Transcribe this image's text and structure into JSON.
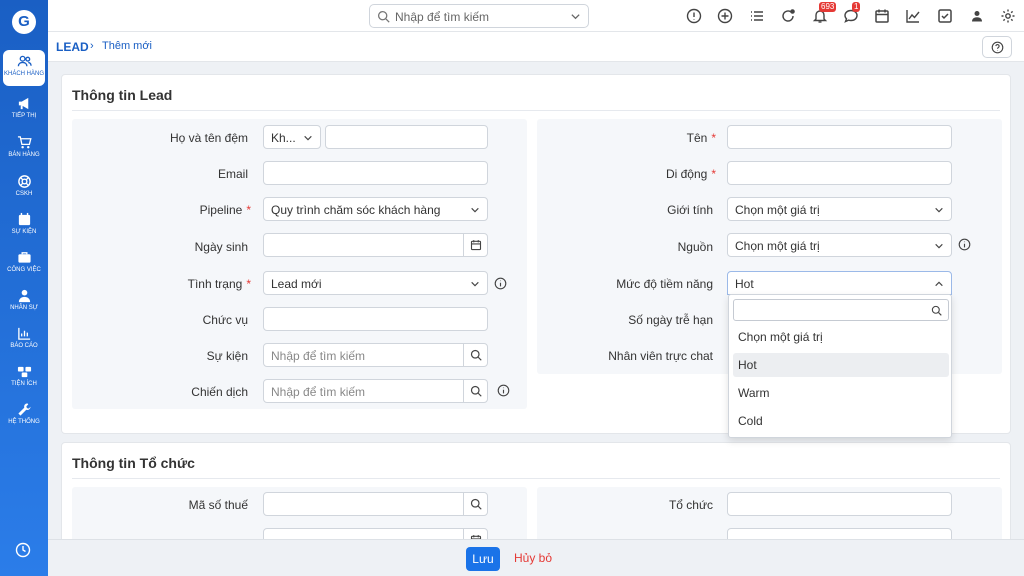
{
  "sidebar": {
    "logo": "G",
    "items": [
      {
        "label": "KHÁCH HÀNG",
        "icon": "users-icon"
      },
      {
        "label": "TIẾP THỊ",
        "icon": "megaphone-icon"
      },
      {
        "label": "BÁN HÀNG",
        "icon": "cart-icon"
      },
      {
        "label": "CSKH",
        "icon": "lifebuoy-icon"
      },
      {
        "label": "SỰ KIỆN",
        "icon": "calendar-icon"
      },
      {
        "label": "CÔNG VIỆC",
        "icon": "briefcase-icon"
      },
      {
        "label": "NHÂN SỰ",
        "icon": "person-icon"
      },
      {
        "label": "BÁO CÁO",
        "icon": "chart-icon"
      },
      {
        "label": "TIỆN ÍCH",
        "icon": "boxes-icon"
      },
      {
        "label": "HỆ THỐNG",
        "icon": "wrench-icon"
      }
    ]
  },
  "topbar": {
    "search_placeholder": "Nhập để tìm kiếm",
    "notifications_count": "693",
    "messages_count": "1"
  },
  "breadcrumb": {
    "root": "LEAD",
    "separator": "›",
    "current": "Thêm mới"
  },
  "lead_section": {
    "title": "Thông tin Lead",
    "left": {
      "fullname_label": "Họ và tên đệm",
      "salutation_value": "Kh...",
      "email_label": "Email",
      "pipeline_label": "Pipeline",
      "pipeline_value": "Quy trình chăm sóc khách hàng",
      "birthday_label": "Ngày sinh",
      "status_label": "Tình trạng",
      "status_value": "Lead mới",
      "position_label": "Chức vụ",
      "event_label": "Sự kiện",
      "event_placeholder": "Nhập để tìm kiếm",
      "campaign_label": "Chiến dịch",
      "campaign_placeholder": "Nhập để tìm kiếm"
    },
    "right": {
      "name_label": "Tên",
      "mobile_label": "Di động",
      "gender_label": "Giới tính",
      "gender_value": "Chọn một giá trị",
      "source_label": "Nguồn",
      "source_value": "Chọn một giá trị",
      "potential_label": "Mức độ tiềm năng",
      "potential_value": "Hot",
      "overdue_label": "Số ngày trễ hạn",
      "chat_label": "Nhân viên trực chat"
    },
    "potential_options": [
      "Chọn một giá trị",
      "Hot",
      "Warm",
      "Cold"
    ]
  },
  "org_section": {
    "title": "Thông tin Tổ chức",
    "tax_label": "Mã số thuế",
    "org_label": "Tổ chức"
  },
  "footer": {
    "save_label": "Lưu",
    "cancel_label": "Hủy bỏ"
  },
  "colors": {
    "brand": "#1a5fc4",
    "primary_button": "#1a73e8",
    "danger": "#e53935"
  }
}
